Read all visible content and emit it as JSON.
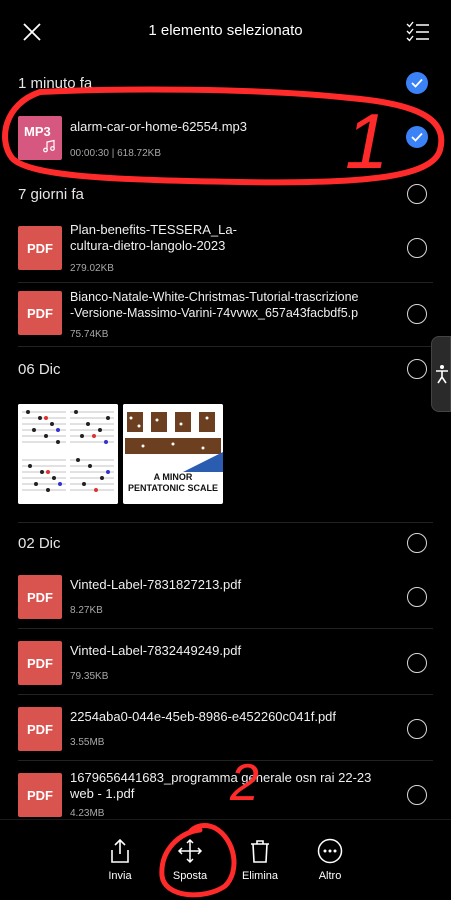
{
  "header": {
    "title": "1 elemento selezionato"
  },
  "sections": {
    "s1": "1 minuto fa",
    "s2": "7 giorni fa",
    "s3": "06 Dic",
    "s4": "02 Dic"
  },
  "files": [
    {
      "name": "alarm-car-or-home-62554.mp3",
      "meta": "00:00:30  |  618.72KB",
      "type": "MP3"
    },
    {
      "name1": "Plan-benefits-TESSERA_La-",
      "name2": "cultura-dietro-langolo-2023",
      "meta": "279.02KB",
      "type": "PDF"
    },
    {
      "name1": "Bianco-Natale-White-Christmas-Tutorial-trascrizione",
      "name2": "-Versione-Massimo-Varini-74vvwx_657a43facbdf5.p",
      "meta": "75.74KB",
      "type": "PDF"
    },
    {
      "name": "Vinted-Label-7831827213.pdf",
      "meta": "8.27KB",
      "type": "PDF"
    },
    {
      "name": "Vinted-Label-7832449249.pdf",
      "meta": "79.35KB",
      "type": "PDF"
    },
    {
      "name": "2254aba0-044e-45eb-8986-e452260c041f.pdf",
      "meta": "3.55MB",
      "type": "PDF"
    },
    {
      "name1": "1679656441683_programma generale osn rai 22-23",
      "name2": "web - 1.pdf",
      "meta": "4.23MB",
      "type": "PDF"
    }
  ],
  "image_tile": {
    "caption1": "A MINOR",
    "caption2": "PENTATONIC SCALE"
  },
  "actions": {
    "send": "Invia",
    "move": "Sposta",
    "delete": "Elimina",
    "more": "Altro"
  },
  "annotations": {
    "one": "1",
    "two": "2"
  },
  "colors": {
    "accent": "#3b82f6",
    "pdf": "#d9534f",
    "mp3": "#d6577f",
    "annotation": "#ff2a2a"
  }
}
